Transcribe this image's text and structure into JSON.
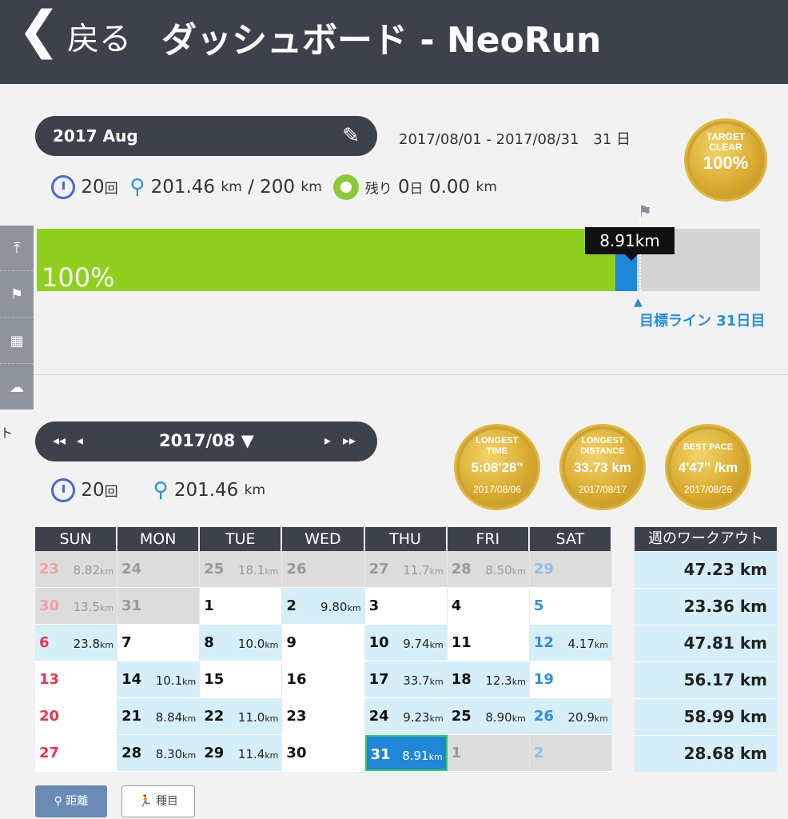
{
  "header": {
    "back_label": "戻る",
    "title": "ダッシュボード - NeoRun"
  },
  "month_selector": {
    "label": "2017 Aug",
    "date_range": "2017/08/01 - 2017/08/31　31 日"
  },
  "target_medal": {
    "line1": "TARGET",
    "line2": "CLEAR",
    "value": "100%"
  },
  "summary": {
    "count_value": "20",
    "count_unit": "回",
    "distance_value": "201.46",
    "distance_unit": "km",
    "goal_text": "/ 200",
    "goal_unit": "km",
    "remain_label": "残り",
    "remain_days": "0",
    "remain_days_unit": "日",
    "remain_km": "0.00",
    "remain_km_unit": "km"
  },
  "progress": {
    "fill_fraction": 0.8,
    "today_fraction_start": 0.8,
    "today_fraction_end": 0.83,
    "percent_label": "100%",
    "tooltip": "8.91km",
    "goal_line_label": "目標ライン 31日目"
  },
  "calendar_nav": {
    "label": "2017/08 ▼",
    "prev_prev": "◂◂",
    "prev": "◂",
    "next": "▸",
    "next_next": "▸▸"
  },
  "records": [
    {
      "title": "LONGEST\nTIME",
      "value": "5:08'28\"",
      "date": "2017/08/06"
    },
    {
      "title": "LONGEST\nDISTANCE",
      "value": "33.73 km",
      "date": "2017/08/17"
    },
    {
      "title": "BEST PACE",
      "value": "4'47\" /km",
      "date": "2017/08/26"
    }
  ],
  "summary2": {
    "count_value": "20",
    "count_unit": "回",
    "distance_value": "201.46",
    "distance_unit": "km"
  },
  "calendar": {
    "headers": [
      "SUN",
      "MON",
      "TUE",
      "WED",
      "THU",
      "FRI",
      "SAT"
    ],
    "weeks": [
      [
        {
          "d": "23",
          "k": "8.82",
          "other": true
        },
        {
          "d": "24",
          "k": "",
          "other": true
        },
        {
          "d": "25",
          "k": "18.1",
          "other": true
        },
        {
          "d": "26",
          "k": "",
          "other": true
        },
        {
          "d": "27",
          "k": "11.7",
          "other": true
        },
        {
          "d": "28",
          "k": "8.50",
          "other": true
        },
        {
          "d": "29",
          "k": "",
          "other": true
        }
      ],
      [
        {
          "d": "30",
          "k": "13.5",
          "other": true
        },
        {
          "d": "31",
          "k": "",
          "other": true
        },
        {
          "d": "1",
          "k": ""
        },
        {
          "d": "2",
          "k": "9.80"
        },
        {
          "d": "3",
          "k": ""
        },
        {
          "d": "4",
          "k": ""
        },
        {
          "d": "5",
          "k": ""
        }
      ],
      [
        {
          "d": "6",
          "k": "23.8"
        },
        {
          "d": "7",
          "k": ""
        },
        {
          "d": "8",
          "k": "10.0"
        },
        {
          "d": "9",
          "k": ""
        },
        {
          "d": "10",
          "k": "9.74"
        },
        {
          "d": "11",
          "k": ""
        },
        {
          "d": "12",
          "k": "4.17"
        }
      ],
      [
        {
          "d": "13",
          "k": ""
        },
        {
          "d": "14",
          "k": "10.1"
        },
        {
          "d": "15",
          "k": ""
        },
        {
          "d": "16",
          "k": ""
        },
        {
          "d": "17",
          "k": "33.7"
        },
        {
          "d": "18",
          "k": "12.3"
        },
        {
          "d": "19",
          "k": ""
        }
      ],
      [
        {
          "d": "20",
          "k": ""
        },
        {
          "d": "21",
          "k": "8.84"
        },
        {
          "d": "22",
          "k": "11.0"
        },
        {
          "d": "23",
          "k": ""
        },
        {
          "d": "24",
          "k": "9.23"
        },
        {
          "d": "25",
          "k": "8.90"
        },
        {
          "d": "26",
          "k": "20.9"
        }
      ],
      [
        {
          "d": "27",
          "k": ""
        },
        {
          "d": "28",
          "k": "8.30"
        },
        {
          "d": "29",
          "k": "11.4"
        },
        {
          "d": "30",
          "k": ""
        },
        {
          "d": "31",
          "k": "8.91",
          "today": true
        },
        {
          "d": "1",
          "k": "",
          "other": true
        },
        {
          "d": "2",
          "k": "",
          "other": true
        }
      ]
    ],
    "km_unit": "km"
  },
  "weekly": {
    "header": "週のワークアウト",
    "values": [
      "47.23 km",
      "23.36 km",
      "47.81 km",
      "56.17 km",
      "58.99 km",
      "28.68 km"
    ]
  },
  "bottom_buttons": {
    "distance": "距離",
    "type": "種目"
  },
  "side_stub": "ト",
  "colors": {
    "header_bg": "#3c414b",
    "progress_green": "#8fd01e",
    "today_blue": "#1f86d8",
    "sunday_red": "#e8364b",
    "saturday_blue": "#2e8ee0",
    "run_day_bg": "#d6eef8"
  }
}
